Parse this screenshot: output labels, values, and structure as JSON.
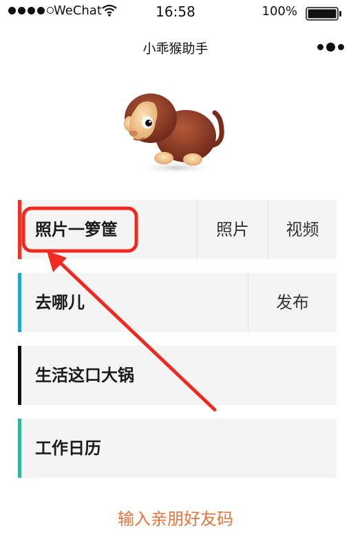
{
  "status_bar": {
    "carrier": "WeChat",
    "time": "16:58",
    "battery": "100%",
    "signal_bars_filled": 4,
    "signal_bars_total": 5
  },
  "nav": {
    "title": "小乖猴助手"
  },
  "menu": [
    {
      "label": "照片一箩筐",
      "actions": [
        "照片",
        "视频"
      ],
      "accent": "#e9342a"
    },
    {
      "label": "去哪儿",
      "actions": [
        "发布"
      ],
      "accent": "#27a6c8"
    },
    {
      "label": "生活这口大锅",
      "actions": [],
      "accent": "#111111"
    },
    {
      "label": "工作日历",
      "actions": [],
      "accent": "#2fb59a"
    }
  ],
  "invite_link": "输入亲朋好友码",
  "colors": {
    "annotation": "#f02a20",
    "link": "#e8733a",
    "card_bg": "#f4f4f4"
  },
  "icons": [
    "wifi-icon",
    "battery-icon",
    "more-icon",
    "monkey-mascot"
  ]
}
